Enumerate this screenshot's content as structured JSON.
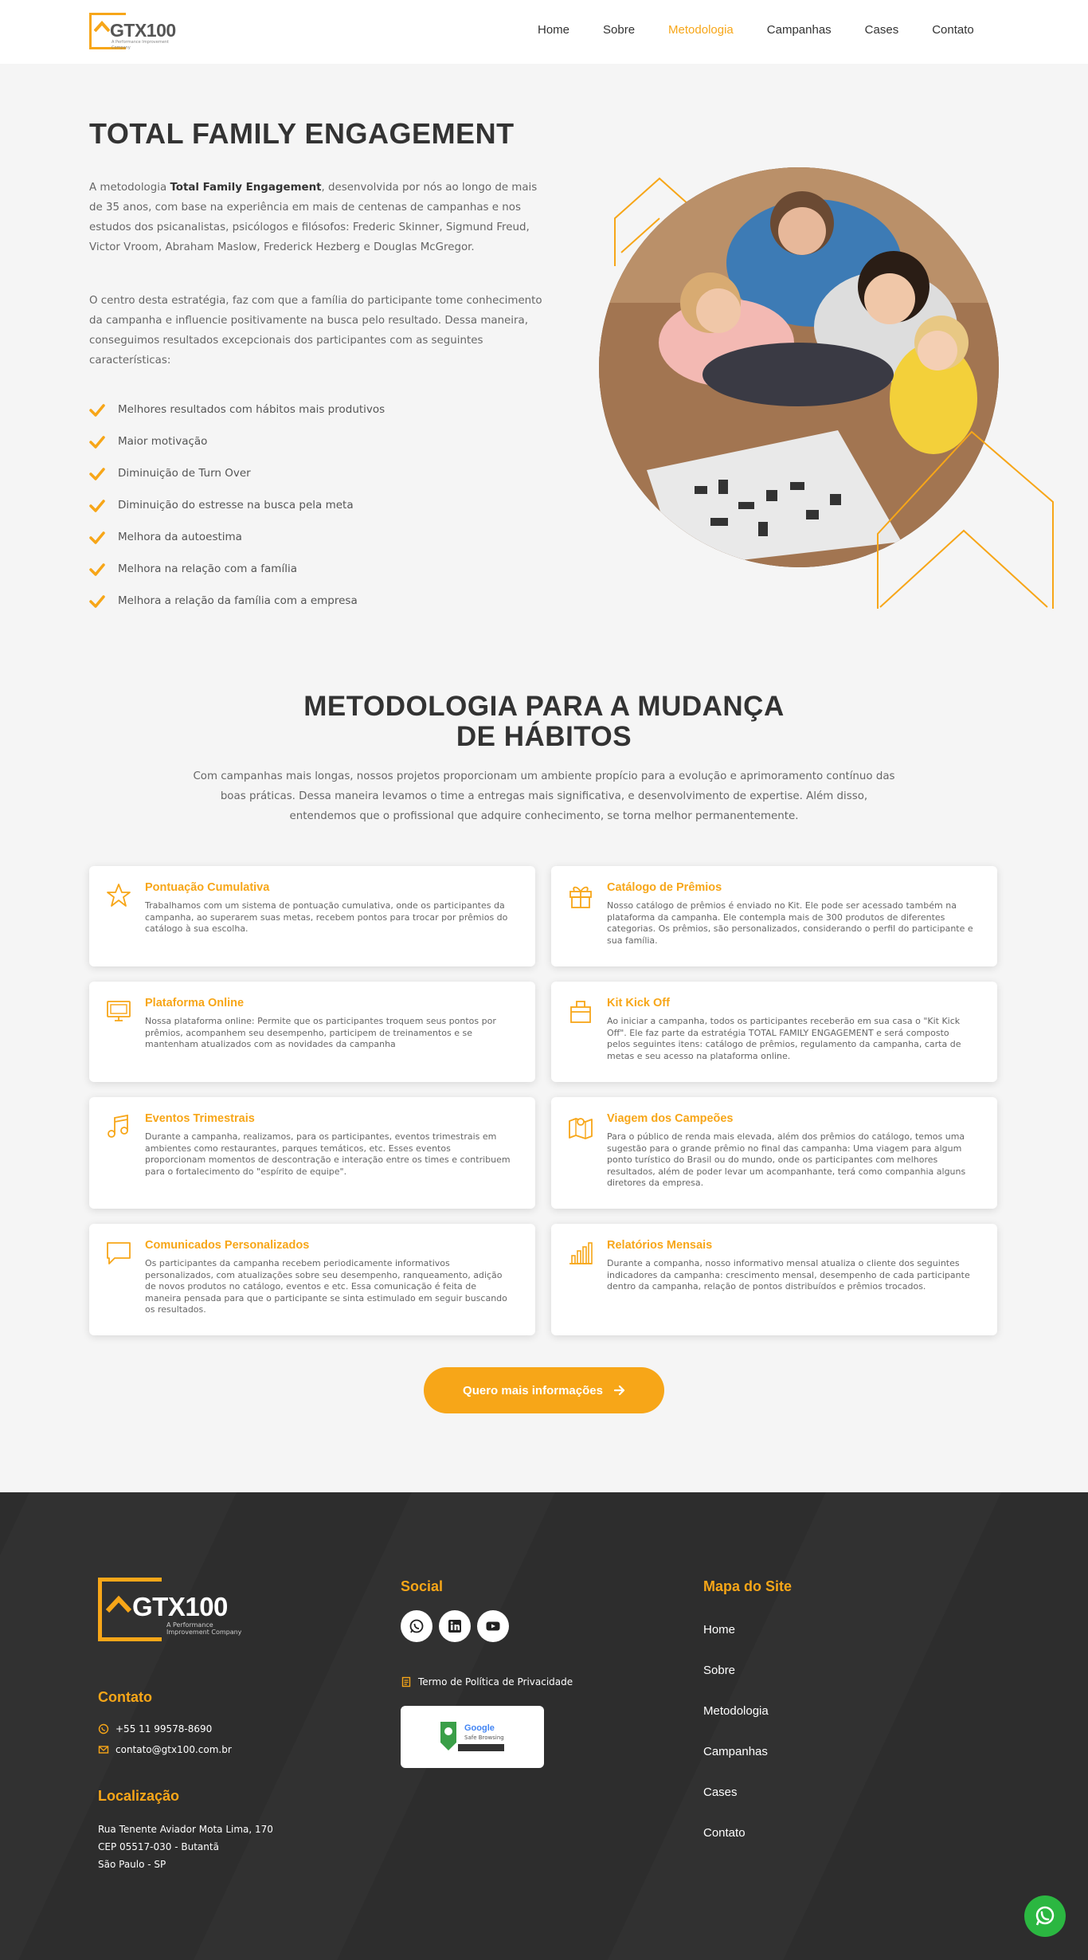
{
  "colors": {
    "accent": "#f7a618",
    "text_dark": "#333333",
    "text": "#666666",
    "footer_bg": "#2d2d2d",
    "whatsapp": "#2bb741"
  },
  "header": {
    "logo_text": "GTX100",
    "logo_sub": "A Performance Improvement Company",
    "nav": [
      {
        "label": "Home"
      },
      {
        "label": "Sobre"
      },
      {
        "label": "Metodologia",
        "active": true
      },
      {
        "label": "Campanhas"
      },
      {
        "label": "Cases"
      },
      {
        "label": "Contato"
      }
    ]
  },
  "hero": {
    "title": "TOTAL FAMILY ENGAGEMENT",
    "p1_before": "A metodologia ",
    "p1_bold": "Total Family Engagement",
    "p1_after": ", desenvolvida por nós ao longo de mais de 35 anos, com base na experiência em mais de centenas de campanhas e nos estudos dos psicanalistas, psicólogos e filósofos: Frederic Skinner, Sigmund Freud, Victor Vroom, Abraham Maslow, Frederick Hezberg e Douglas McGregor.",
    "p2": "O centro desta estratégia, faz com que a família do participante tome conhecimento da campanha e influencie positivamente na busca pelo resultado. Dessa maneira, conseguimos resultados excepcionais dos participantes com as seguintes características:",
    "checklist": [
      "Melhores resultados com hábitos mais produtivos",
      "Maior motivação",
      "Diminuição de Turn Over",
      "Diminuição do estresse na busca pela meta",
      "Melhora da autoestima",
      "Melhora na relação com a família",
      "Melhora a relação da família com a empresa"
    ],
    "image_icon": "family-photo"
  },
  "methodology": {
    "title_line1": "METODOLOGIA PARA A MUDANÇA",
    "title_line2": "DE HÁBITOS",
    "description": "Com campanhas mais longas, nossos projetos proporcionam um ambiente propício para a evolução e aprimoramento contínuo das boas práticas. Dessa maneira levamos o time a entregas mais significativa, e desenvolvimento de expertise. Além disso, entendemos que o profissional que adquire conhecimento, se torna melhor permanentemente.",
    "cards": [
      {
        "icon": "star-icon",
        "title": "Pontuação Cumulativa",
        "text": "Trabalhamos com um sistema de pontuação cumulativa, onde os participantes da campanha, ao superarem suas metas, recebem pontos para trocar por prêmios do catálogo à sua escolha."
      },
      {
        "icon": "gift-icon",
        "title": "Catálogo de Prêmios",
        "text": "Nosso catálogo de prêmios é enviado no Kit. Ele pode ser acessado também na plataforma da campanha. Ele contempla mais de 300 produtos de diferentes categorias. Os prêmios, são personalizados, considerando o perfil do participante e sua família."
      },
      {
        "icon": "monitor-icon",
        "title": "Plataforma Online",
        "text": "Nossa plataforma online: Permite que os participantes troquem seus pontos por prêmios, acompanhem seu desempenho, participem de treinamentos e se mantenham atualizados com as novidades da campanha"
      },
      {
        "icon": "box-icon",
        "title": "Kit Kick Off",
        "text": "Ao iniciar a campanha, todos os participantes receberão em sua casa o \"Kit Kick Off\". Ele faz parte da estratégia TOTAL FAMILY ENGAGEMENT e será composto pelos seguintes itens: catálogo de prêmios, regulamento da campanha, carta de metas e seu acesso na plataforma online."
      },
      {
        "icon": "music-icon",
        "title": "Eventos Trimestrais",
        "text": "Durante a campanha, realizamos, para os participantes, eventos trimestrais em ambientes como restaurantes, parques temáticos, etc. Esses eventos proporcionam momentos de descontração e interação entre os times e contribuem para o fortalecimento do \"espírito de equipe\"."
      },
      {
        "icon": "map-icon",
        "title": "Viagem dos Campeões",
        "text": "Para o público de renda mais elevada, além dos prêmios do catálogo, temos uma sugestão para o grande prêmio no final das campanha: Uma viagem para algum ponto turístico do Brasil ou do mundo, onde os participantes com melhores resultados, além de poder levar um acompanhante, terá como companhia alguns diretores da empresa."
      },
      {
        "icon": "chat-icon",
        "title": "Comunicados Personalizados",
        "text": "Os participantes da campanha recebem periodicamente informativos personalizados, com atualizações sobre seu desempenho, ranqueamento, adição de novos produtos no catálogo, eventos e etc. Essa comunicação é feita de maneira pensada para que o participante se sinta estimulado em seguir buscando os resultados."
      },
      {
        "icon": "bar-chart-icon",
        "title": "Relatórios Mensais",
        "text": "Durante a companha, nosso informativo mensal atualiza o cliente dos seguintes indicadores da campanha: crescimento mensal, desempenho de cada participante dentro da campanha, relação de pontos distribuídos e prêmios trocados."
      }
    ],
    "cta_label": "Quero mais informações"
  },
  "footer": {
    "logo_text": "GTX100",
    "logo_sub": "A Performance Improvement Company",
    "contact_heading": "Contato",
    "phone": "+55 11 99578-8690",
    "email": "contato@gtx100.com.br",
    "location_heading": "Localização",
    "address_line1": "Rua Tenente Aviador Mota Lima, 170",
    "address_line2": "CEP 05517-030 - Butantã",
    "address_line3": "São Paulo - SP",
    "social_heading": "Social",
    "social_icons": [
      "whatsapp-icon",
      "linkedin-icon",
      "youtube-icon"
    ],
    "privacy_label": "Termo de Política de Privacidade",
    "badge_title": "Google",
    "badge_sub": "Safe Browsing",
    "sitemap_heading": "Mapa do Site",
    "sitemap": [
      "Home",
      "Sobre",
      "Metodologia",
      "Campanhas",
      "Cases",
      "Contato"
    ]
  }
}
